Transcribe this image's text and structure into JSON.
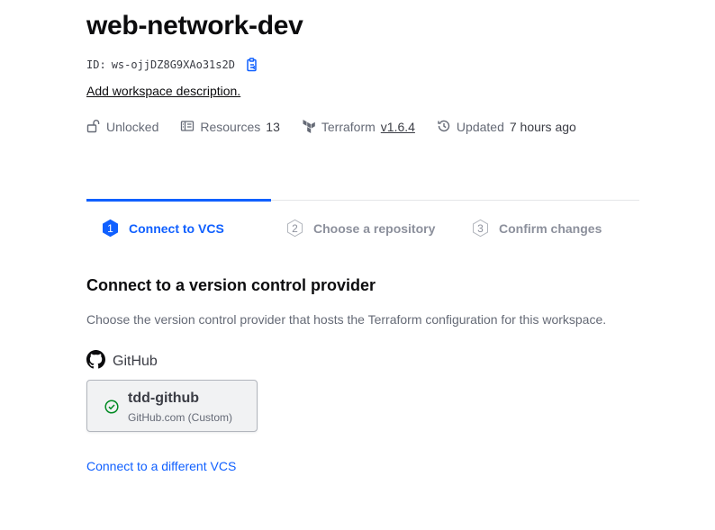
{
  "workspace": {
    "name": "web-network-dev",
    "id_label": "ID:",
    "id_value": "ws-ojjDZ8G9XAo31s2D",
    "add_description": "Add workspace description."
  },
  "meta": {
    "lock_status": "Unlocked",
    "resources_label": "Resources",
    "resources_count": "13",
    "terraform_label": "Terraform",
    "terraform_version": "v1.6.4",
    "updated_label": "Updated",
    "updated_value": "7 hours ago"
  },
  "stepper": {
    "steps": [
      {
        "number": "1",
        "label": "Connect to VCS",
        "state": "active"
      },
      {
        "number": "2",
        "label": "Choose a repository",
        "state": "pending"
      },
      {
        "number": "3",
        "label": "Confirm changes",
        "state": "pending"
      }
    ]
  },
  "section": {
    "title": "Connect to a version control provider",
    "description": "Choose the version control provider that hosts the Terraform configuration for this workspace."
  },
  "provider": {
    "heading": "GitHub",
    "icon": "github-icon",
    "connection": {
      "name": "tdd-github",
      "subtitle": "GitHub.com (Custom)",
      "status": "connected"
    }
  },
  "links": {
    "connect_different": "Connect to a different VCS"
  },
  "colors": {
    "accent": "#1060ff",
    "success": "#008a22",
    "muted": "#8c909c"
  }
}
